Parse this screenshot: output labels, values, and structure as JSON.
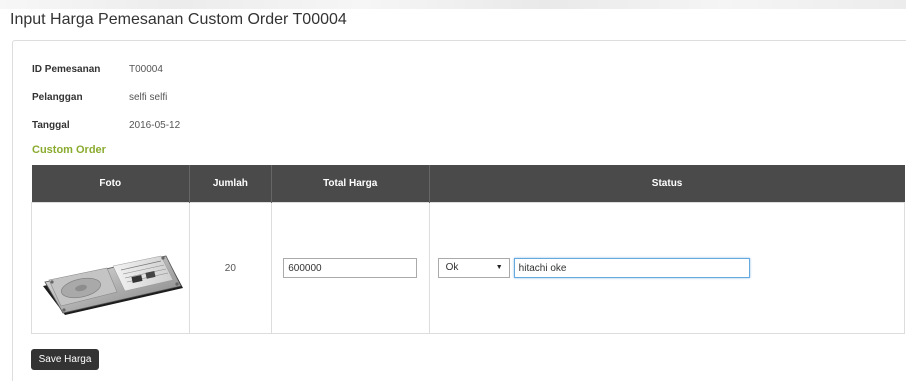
{
  "page": {
    "title": "Input Harga Pemesanan Custom Order T00004"
  },
  "info": {
    "id_label": "ID Pemesanan",
    "id_value": "T00004",
    "customer_label": "Pelanggan",
    "customer_value": "selfi selfi",
    "date_label": "Tanggal",
    "date_value": "2016-05-12"
  },
  "section_title": "Custom Order",
  "table": {
    "headers": [
      "Foto",
      "Jumlah",
      "Total Harga",
      "Status"
    ],
    "rows": [
      {
        "photo_alt": "hard-disk-drive",
        "quantity": "20",
        "total_price": "600000",
        "status_selected": "Ok",
        "status_note": "hitachi oke"
      }
    ]
  },
  "save_button": "Save Harga"
}
